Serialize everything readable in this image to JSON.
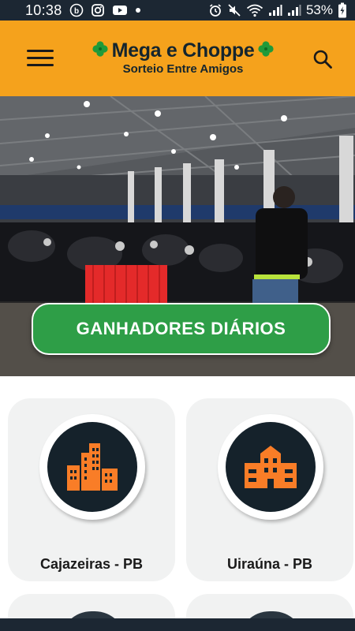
{
  "status_bar": {
    "time": "10:38",
    "battery": "53%",
    "icons": [
      "b-circle-icon",
      "instagram-icon",
      "youtube-icon",
      "dot-icon",
      "alarm-icon",
      "mute-icon",
      "wifi-icon",
      "signal-icon",
      "signal-icon",
      "battery-icon"
    ]
  },
  "header": {
    "title": "Mega e Choppe",
    "subtitle": "Sorteio Entre Amigos",
    "logo_icon": "clover-icon",
    "left_icon": "menu-icon",
    "right_icon": "search-icon",
    "background": "#f5a21c"
  },
  "hero": {
    "button_label": "GANHADORES DIÁRIOS",
    "button_color": "#2e9e47"
  },
  "cards": [
    {
      "label": "Cajazeiras - PB",
      "icon": "buildings-icon"
    },
    {
      "label": "Uiraúna - PB",
      "icon": "building-icon"
    }
  ],
  "colors": {
    "accent_orange": "#f97d27",
    "icon_circle": "#15222b",
    "card_bg": "#f1f2f2"
  }
}
